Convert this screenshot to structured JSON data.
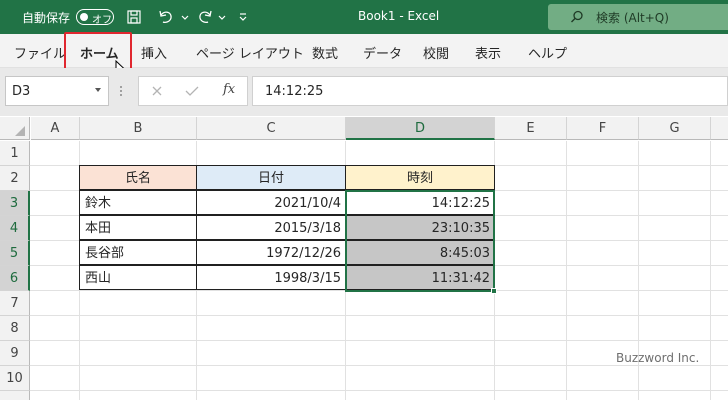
{
  "titlebar": {
    "autosave_label": "自動保存",
    "autosave_state": "オフ",
    "document_title": "Book1  -  Excel",
    "search_placeholder": "検索 (Alt+Q)",
    "icons": [
      "save-icon",
      "undo-icon",
      "redo-icon",
      "customize-icon",
      "search-icon"
    ],
    "bar_color": "#217346"
  },
  "ribbon": {
    "tabs": [
      {
        "label": "ファイル"
      },
      {
        "label": "ホーム",
        "active": true
      },
      {
        "label": "挿入"
      },
      {
        "label": "ページ レイアウト"
      },
      {
        "label": "数式"
      },
      {
        "label": "データ"
      },
      {
        "label": "校閲"
      },
      {
        "label": "表示"
      },
      {
        "label": "ヘルプ"
      }
    ],
    "highlight_color": "#e0272f"
  },
  "formula_bar": {
    "name_box": "D3",
    "fx": "fx",
    "formula_value": "14:12:25"
  },
  "sheet": {
    "columns": [
      "A",
      "B",
      "C",
      "D",
      "E",
      "F",
      "G"
    ],
    "rows": [
      "1",
      "2",
      "3",
      "4",
      "5",
      "6",
      "7",
      "8",
      "9",
      "10"
    ],
    "selected_column": "D",
    "selected_rows": [
      "3",
      "4",
      "5",
      "6"
    ],
    "table": {
      "headers": [
        "氏名",
        "日付",
        "時刻"
      ],
      "header_colors": [
        "#fbe2d5",
        "#deebf7",
        "#fff2cc"
      ],
      "rows": [
        {
          "name": "鈴木",
          "date": "2021/10/4",
          "time": "14:12:25"
        },
        {
          "name": "本田",
          "date": "2015/3/18",
          "time": "23:10:35"
        },
        {
          "name": "長谷部",
          "date": "1972/12/26",
          "time": "8:45:03"
        },
        {
          "name": "西山",
          "date": "1998/3/15",
          "time": "11:31:42"
        }
      ]
    }
  },
  "watermark": "Buzzword Inc."
}
